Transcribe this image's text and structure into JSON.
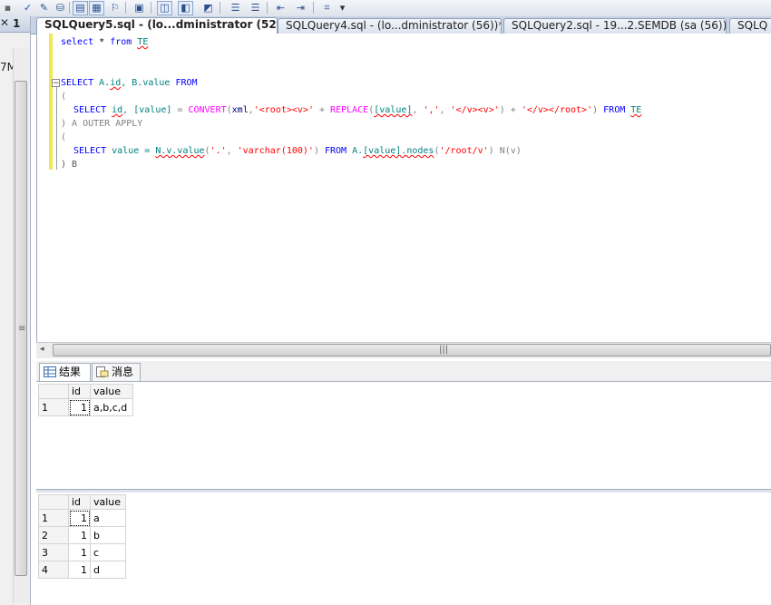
{
  "toolbar": {
    "icons": [
      "new-query",
      "check-icon",
      "parse-icon",
      "display-plan-icon",
      "results-text-icon",
      "results-grid-icon",
      "results-file-icon",
      "include-plan-icon",
      "client-stats-icon",
      "comment-icon",
      "uncomment-icon",
      "indent-icon",
      "outdent-icon",
      "specify-values-icon"
    ],
    "overflow_glyph": "▾"
  },
  "left_panel": {
    "header_text": "1",
    "close_glyph": "✕",
    "tree_fragment": "7M",
    "grip_glyph": "≡"
  },
  "tabs": [
    {
      "label": "SQLQuery5.sql - (lo...dministrator (52))*",
      "active": true
    },
    {
      "label": "SQLQuery4.sql - (lo...dministrator (56))*",
      "active": false
    },
    {
      "label": "SQLQuery2.sql - 19...2.SEMDB (sa (56))*",
      "active": false
    },
    {
      "label": "SQLQ",
      "active": false
    }
  ],
  "editor": {
    "line1": {
      "kw1": "select",
      "op": " * ",
      "kw2": "from",
      "tbl": "TE"
    },
    "line3": {
      "kw1": "SELECT",
      "a": "A.",
      "aid": "id",
      "mid": ", B.value ",
      "kw2": "FROM"
    },
    "line4": "(",
    "line5": {
      "kw1": "SELECT",
      "id": "id",
      "p1": ", ",
      "val": "[value]",
      "p2": " = ",
      "fn1": "CONVERT",
      "p3": "(",
      "xml": "xml",
      "p4": ",",
      "s1": "'<root><v>'",
      "p5": " + ",
      "fn2": "REPLACE",
      "p6": "(",
      "val2": "[value]",
      "p7": ", ",
      "s2": "','",
      "p8": ", ",
      "s3": "'</v><v>'",
      "p9": ") + ",
      "s4": "'</v></root>'",
      "p10": ") ",
      "kw2": "FROM",
      "p11": " ",
      "tbl": "TE"
    },
    "line6": {
      "g1": ") A ",
      "kw": "OUTER APPLY"
    },
    "line7": "(",
    "line8": {
      "kw1": "SELECT",
      "p1": " value = ",
      "n": "N.v.value",
      "p2": "(",
      "s1": "'.'",
      "p3": ", ",
      "s2": "'varchar(100)'",
      "p4": ") ",
      "kw2": "FROM",
      "p5": " ",
      "a": "A.",
      "av": "[value].nodes",
      "p6": "(",
      "s3": "'/root/v'",
      "p7": ") N(v)"
    },
    "line9": ") B",
    "collapse_glyph": "−"
  },
  "hscroll": {
    "grip": "|||",
    "arrow": "◂"
  },
  "results_tabs": [
    {
      "label": "结果",
      "active": true
    },
    {
      "label": "消息",
      "active": false
    }
  ],
  "grid1": {
    "columns": [
      "id",
      "value"
    ],
    "rows": [
      {
        "n": "1",
        "id": "1",
        "value": "a,b,c,d"
      }
    ]
  },
  "grid2": {
    "columns": [
      "id",
      "value"
    ],
    "rows": [
      {
        "n": "1",
        "id": "1",
        "value": "a"
      },
      {
        "n": "2",
        "id": "1",
        "value": "b"
      },
      {
        "n": "3",
        "id": "1",
        "value": "c"
      },
      {
        "n": "4",
        "id": "1",
        "value": "d"
      }
    ]
  }
}
